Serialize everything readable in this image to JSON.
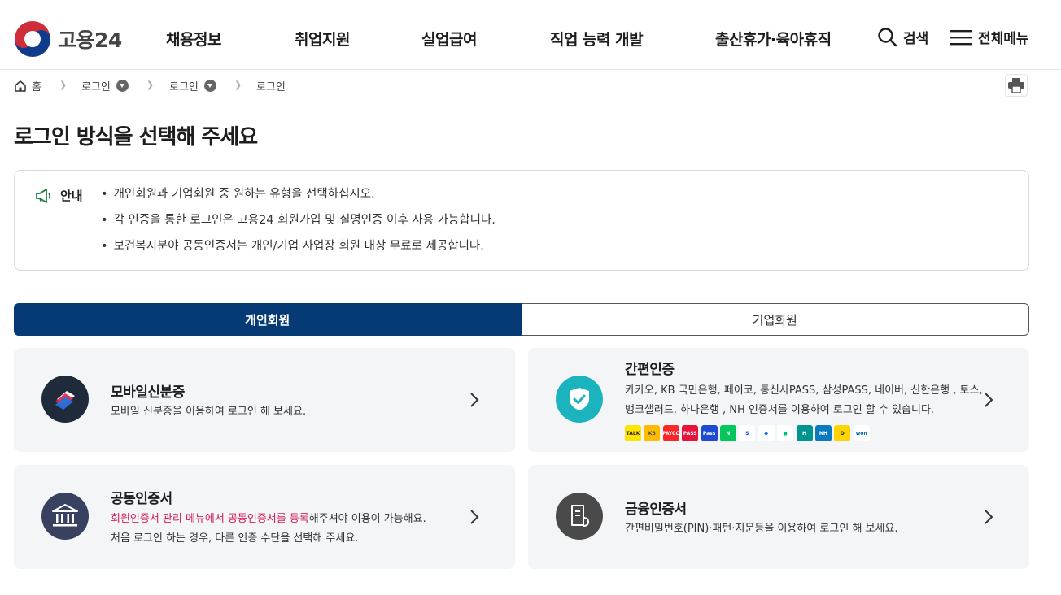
{
  "header": {
    "logo_text": "고용24",
    "nav": [
      "채용정보",
      "취업지원",
      "실업급여",
      "직업 능력 개발",
      "출산휴가·육아휴직"
    ],
    "search_label": "검색",
    "menu_label": "전체메뉴"
  },
  "breadcrumb": {
    "home": "홈",
    "items": [
      "로그인",
      "로그인",
      "로그인"
    ]
  },
  "page_title": "로그인 방식을 선택해 주세요",
  "notice": {
    "label": "안내",
    "items": [
      "개인회원과 기업회원 중 원하는 유형을 선택하십시오.",
      "각 인증을 통한 로그인은 고용24 회원가입 및 실명인증 이후 사용 가능합니다.",
      "보건복지분야 공동인증서는 개인/기업 사업장 회원 대상 무료로 제공합니다."
    ]
  },
  "tabs": [
    {
      "label": "개인회원",
      "active": true
    },
    {
      "label": "기업회원",
      "active": false
    }
  ],
  "cards": {
    "mobile_id": {
      "title": "모바일신분증",
      "desc": "모바일 신분증을 이용하여 로그인 해 보세요."
    },
    "simple_auth": {
      "title": "간편인증",
      "desc1": "카카오, KB 국민은행, 페이코, 통신사PASS, 삼성PASS, 네이버, 신한은행 , 토스,",
      "desc2": "뱅크샐러드, 하나은행 , NH 인증서를 이용하여 로그인 할 수 있습니다.",
      "brands": [
        {
          "name": "kakao",
          "text": "TALK",
          "bg": "#fee500",
          "fg": "#3c1e1e"
        },
        {
          "name": "kb",
          "text": "KB",
          "bg": "#ffbc00",
          "fg": "#5a4a3a"
        },
        {
          "name": "payco",
          "text": "PAYCO",
          "bg": "#fa2828",
          "fg": "#ffffff"
        },
        {
          "name": "pass",
          "text": "PASS",
          "bg": "#e6143c",
          "fg": "#ffffff"
        },
        {
          "name": "samsung-pass",
          "text": "Pass",
          "bg": "#1e4bd2",
          "fg": "#ffffff"
        },
        {
          "name": "naver",
          "text": "N",
          "bg": "#03c75a",
          "fg": "#ffffff"
        },
        {
          "name": "shinhan",
          "text": "S",
          "bg": "#ffffff",
          "fg": "#0046ff"
        },
        {
          "name": "toss",
          "text": "◆",
          "bg": "#ffffff",
          "fg": "#0064ff"
        },
        {
          "name": "banksalad",
          "text": "●",
          "bg": "#ffffff",
          "fg": "#00c073"
        },
        {
          "name": "hana",
          "text": "H",
          "bg": "#009490",
          "fg": "#ffffff"
        },
        {
          "name": "nh",
          "text": "NH",
          "bg": "#0a7ac0",
          "fg": "#ffffff"
        },
        {
          "name": "d-cert",
          "text": "D",
          "bg": "#ffd400",
          "fg": "#1e1e1e"
        },
        {
          "name": "woori",
          "text": "won",
          "bg": "#ffffff",
          "fg": "#0067ac"
        }
      ]
    },
    "joint_cert": {
      "title": "공동인증서",
      "desc_highlight": "회원인증서 관리 메뉴에서 공동인증서를 등록",
      "desc_rest": "해주셔야 이용이 가능해요.",
      "desc2": "처음 로그인 하는 경우, 다른 인증 수단을 선택해 주세요."
    },
    "finance_cert": {
      "title": "금융인증서",
      "desc": "간편비밀번호(PIN)·패턴·지문등을 이용하여 로그인 해 보세요."
    }
  },
  "colors": {
    "primary": "#063a74",
    "highlight": "#d41c5c",
    "card_bg": "#f4f5f6",
    "mobile_icon_bg": "#1f2a3a",
    "simple_icon_bg": "#1bb3bd",
    "joint_icon_bg": "#384260",
    "finance_icon_bg": "#4a4a4a"
  }
}
